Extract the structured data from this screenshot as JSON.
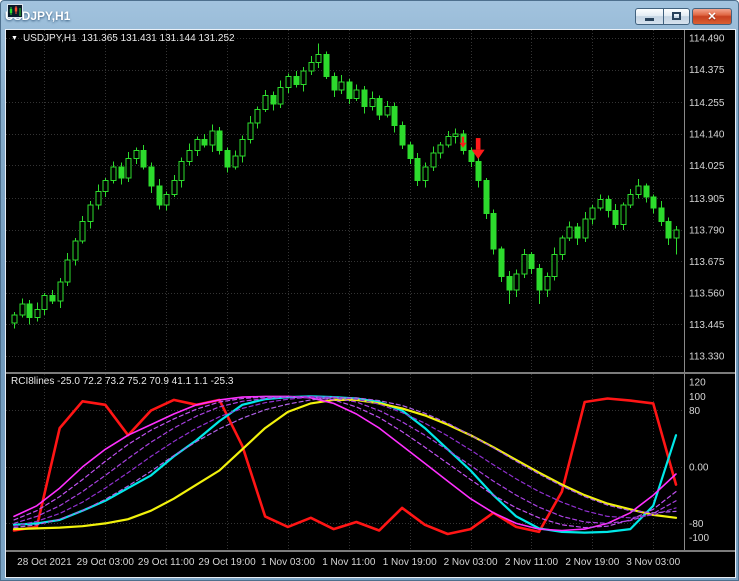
{
  "window": {
    "title": "USDJPY,H1",
    "close_glyph": "✕"
  },
  "main_chart": {
    "nav_arrow": "▼",
    "symbol": "USDJPY,H1",
    "ohlc": "131.365 131.431 131.144 131.252"
  },
  "indicator": {
    "info": "RCI8lines -25.0 72.2 73.2 75.2 70.9 41.1 1.1 -25.3"
  },
  "chart_data": [
    {
      "type": "candlestick",
      "title": "USDJPY H1",
      "grid_color": "#343434",
      "axis_text_color": "#d6d6d6",
      "candle_line_color": "#2ddb2d",
      "bull_fill": "#000000",
      "bear_fill": "#2ddb2d",
      "price_axis_labels": [
        "114.490",
        "114.375",
        "114.255",
        "114.140",
        "114.025",
        "113.905",
        "113.790",
        "113.675",
        "113.560",
        "113.445",
        "113.330"
      ],
      "time_axis_labels": [
        {
          "text": "28 Oct 2021",
          "bar": 4
        },
        {
          "text": "29 Oct 03:00",
          "bar": 12
        },
        {
          "text": "29 Oct 11:00",
          "bar": 20
        },
        {
          "text": "29 Oct 19:00",
          "bar": 28
        },
        {
          "text": "1 Nov 03:00",
          "bar": 36
        },
        {
          "text": "1 Nov 11:00",
          "bar": 44
        },
        {
          "text": "1 Nov 19:00",
          "bar": 52
        },
        {
          "text": "2 Nov 03:00",
          "bar": 60
        },
        {
          "text": "2 Nov 11:00",
          "bar": 68
        },
        {
          "text": "2 Nov 19:00",
          "bar": 76
        },
        {
          "text": "3 Nov 03:00",
          "bar": 84
        }
      ],
      "candles": [
        [
          113.45,
          113.49,
          113.43,
          113.48
        ],
        [
          113.48,
          113.54,
          113.47,
          113.52
        ],
        [
          113.52,
          113.535,
          113.445,
          113.47
        ],
        [
          113.47,
          113.525,
          113.455,
          113.5
        ],
        [
          113.5,
          113.56,
          113.48,
          113.55
        ],
        [
          113.55,
          113.57,
          113.52,
          113.53
        ],
        [
          113.53,
          113.615,
          113.505,
          113.6
        ],
        [
          113.6,
          113.705,
          113.585,
          113.68
        ],
        [
          113.68,
          113.76,
          113.66,
          113.75
        ],
        [
          113.75,
          113.84,
          113.74,
          113.82
        ],
        [
          113.82,
          113.895,
          113.795,
          113.88
        ],
        [
          113.88,
          113.955,
          113.865,
          113.93
        ],
        [
          113.93,
          113.98,
          113.91,
          113.97
        ],
        [
          113.97,
          114.04,
          113.96,
          114.02
        ],
        [
          114.02,
          114.035,
          113.955,
          113.98
        ],
        [
          113.98,
          114.075,
          113.965,
          114.05
        ],
        [
          114.05,
          114.09,
          114.03,
          114.08
        ],
        [
          114.08,
          114.1,
          114.01,
          114.02
        ],
        [
          114.02,
          114.035,
          113.925,
          113.95
        ],
        [
          113.95,
          113.975,
          113.865,
          113.88
        ],
        [
          113.88,
          113.93,
          113.86,
          113.92
        ],
        [
          113.92,
          113.99,
          113.91,
          113.97
        ],
        [
          113.97,
          114.055,
          113.945,
          114.04
        ],
        [
          114.04,
          114.105,
          114.025,
          114.08
        ],
        [
          114.08,
          114.13,
          114.06,
          114.12
        ],
        [
          114.12,
          114.14,
          114.09,
          114.1
        ],
        [
          114.1,
          114.175,
          114.075,
          114.15
        ],
        [
          114.15,
          114.165,
          114.065,
          114.08
        ],
        [
          114.08,
          114.09,
          114.0,
          114.02
        ],
        [
          114.02,
          114.08,
          114.01,
          114.06
        ],
        [
          114.06,
          114.135,
          114.035,
          114.12
        ],
        [
          114.12,
          114.205,
          114.105,
          114.18
        ],
        [
          114.18,
          114.24,
          114.16,
          114.23
        ],
        [
          114.23,
          114.3,
          114.22,
          114.28
        ],
        [
          114.28,
          114.295,
          114.225,
          114.25
        ],
        [
          114.25,
          114.335,
          114.235,
          114.31
        ],
        [
          114.31,
          114.36,
          114.29,
          114.35
        ],
        [
          114.35,
          114.37,
          114.31,
          114.32
        ],
        [
          114.32,
          114.385,
          114.295,
          114.37
        ],
        [
          114.37,
          114.425,
          114.355,
          114.4
        ],
        [
          114.4,
          114.47,
          114.38,
          114.43
        ],
        [
          114.43,
          114.44,
          114.34,
          114.35
        ],
        [
          114.35,
          114.365,
          114.275,
          114.3
        ],
        [
          114.3,
          114.355,
          114.285,
          114.33
        ],
        [
          114.33,
          114.34,
          114.25,
          114.27
        ],
        [
          114.27,
          114.32,
          114.26,
          114.3
        ],
        [
          114.3,
          114.315,
          114.215,
          114.24
        ],
        [
          114.24,
          114.295,
          114.225,
          114.27
        ],
        [
          114.27,
          114.28,
          114.19,
          114.21
        ],
        [
          114.21,
          114.26,
          114.2,
          114.24
        ],
        [
          114.24,
          114.255,
          114.145,
          114.17
        ],
        [
          114.17,
          114.185,
          114.085,
          114.1
        ],
        [
          114.1,
          114.11,
          114.03,
          114.05
        ],
        [
          114.05,
          114.07,
          113.95,
          113.97
        ],
        [
          113.97,
          114.035,
          113.945,
          114.02
        ],
        [
          114.02,
          114.095,
          114.005,
          114.07
        ],
        [
          114.07,
          114.11,
          114.05,
          114.1
        ],
        [
          114.1,
          114.15,
          114.09,
          114.13
        ],
        [
          114.13,
          114.16,
          114.105,
          114.14
        ],
        [
          114.14,
          114.155,
          114.065,
          114.08
        ],
        [
          114.08,
          114.09,
          114.02,
          114.04
        ],
        [
          114.04,
          114.055,
          113.945,
          113.97
        ],
        [
          113.97,
          113.98,
          113.83,
          113.85
        ],
        [
          113.85,
          113.865,
          113.7,
          113.72
        ],
        [
          113.72,
          113.73,
          113.6,
          113.62
        ],
        [
          113.62,
          113.64,
          113.52,
          113.57
        ],
        [
          113.57,
          113.645,
          113.545,
          113.63
        ],
        [
          113.63,
          113.72,
          113.615,
          113.7
        ],
        [
          113.7,
          113.71,
          113.63,
          113.65
        ],
        [
          113.65,
          113.665,
          113.52,
          113.57
        ],
        [
          113.57,
          113.635,
          113.545,
          113.62
        ],
        [
          113.62,
          113.725,
          113.605,
          113.7
        ],
        [
          113.7,
          113.77,
          113.68,
          113.76
        ],
        [
          113.76,
          113.82,
          113.75,
          113.8
        ],
        [
          113.8,
          113.815,
          113.735,
          113.76
        ],
        [
          113.76,
          113.855,
          113.745,
          113.83
        ],
        [
          113.83,
          113.88,
          113.81,
          113.87
        ],
        [
          113.87,
          113.92,
          113.86,
          113.9
        ],
        [
          113.9,
          113.915,
          113.835,
          113.86
        ],
        [
          113.86,
          113.885,
          113.795,
          113.81
        ],
        [
          113.81,
          113.89,
          113.79,
          113.88
        ],
        [
          113.88,
          113.94,
          113.87,
          113.92
        ],
        [
          113.92,
          113.975,
          113.905,
          113.95
        ],
        [
          113.95,
          113.96,
          113.89,
          113.91
        ],
        [
          113.91,
          113.92,
          113.85,
          113.87
        ],
        [
          113.87,
          113.895,
          113.805,
          113.82
        ],
        [
          113.82,
          113.835,
          113.735,
          113.76
        ],
        [
          113.76,
          113.805,
          113.7,
          113.79
        ]
      ],
      "annotations": [
        {
          "type": "arrow-down",
          "bar": 59,
          "price": 114.13,
          "size": 11,
          "color": "#ff1a1a"
        },
        {
          "type": "arrow-down",
          "bar": 61,
          "price": 114.125,
          "size": 21,
          "color": "#ff1a1a"
        }
      ]
    },
    {
      "type": "line",
      "name": "RCI8lines",
      "axis_labels": [
        "120",
        "100",
        "80",
        "0.00",
        "-80",
        "-100"
      ],
      "level_lines": [
        80,
        0,
        -80
      ],
      "y_range": [
        -112,
        126
      ],
      "x_bar_step": 3,
      "series": [
        {
          "name": "red",
          "color": "#ff1515",
          "width": 2.6,
          "dash": "",
          "values": [
            -90,
            -85,
            55,
            93,
            88,
            45,
            80,
            95,
            88,
            95,
            30,
            -70,
            -85,
            -72,
            -88,
            -78,
            -90,
            -58,
            -82,
            -95,
            -88,
            -65,
            -85,
            -92,
            -35,
            92,
            97,
            94,
            90,
            -25
          ]
        },
        {
          "name": "cyan",
          "color": "#00e8e8",
          "width": 2.2,
          "dash": "",
          "values": [
            -82,
            -80,
            -75,
            -62,
            -48,
            -30,
            -12,
            15,
            38,
            65,
            88,
            96,
            99,
            100,
            99,
            97,
            92,
            80,
            55,
            25,
            -5,
            -40,
            -70,
            -87,
            -92,
            -93,
            -92,
            -88,
            -55,
            45
          ]
        },
        {
          "name": "yellow",
          "color": "#f2f20c",
          "width": 2.2,
          "dash": "",
          "values": [
            -88,
            -87,
            -86,
            -84,
            -80,
            -74,
            -62,
            -45,
            -25,
            -5,
            25,
            55,
            78,
            90,
            95,
            95,
            90,
            83,
            73,
            60,
            45,
            28,
            10,
            -8,
            -25,
            -40,
            -52,
            -60,
            -68,
            -72
          ]
        },
        {
          "name": "magenta",
          "color": "#ff30ff",
          "width": 1.6,
          "dash": "",
          "values": [
            -70,
            -55,
            -30,
            0,
            25,
            45,
            60,
            75,
            88,
            95,
            99,
            100,
            100,
            98,
            90,
            75,
            55,
            30,
            5,
            -20,
            -45,
            -65,
            -80,
            -88,
            -90,
            -88,
            -80,
            -65,
            -40,
            -10
          ]
        },
        {
          "name": "violet-1",
          "color": "#c050f0",
          "width": 1.2,
          "dash": "4,3",
          "values": [
            -75,
            -62,
            -42,
            -18,
            8,
            32,
            52,
            68,
            82,
            92,
            97,
            99,
            100,
            99,
            95,
            85,
            70,
            50,
            28,
            5,
            -18,
            -40,
            -58,
            -72,
            -82,
            -86,
            -84,
            -75,
            -60,
            -35
          ]
        },
        {
          "name": "violet-2",
          "color": "#a840e0",
          "width": 1.2,
          "dash": "4,3",
          "values": [
            -80,
            -70,
            -55,
            -35,
            -12,
            12,
            35,
            55,
            72,
            85,
            93,
            97,
            99,
            100,
            98,
            92,
            80,
            64,
            45,
            24,
            2,
            -20,
            -40,
            -57,
            -70,
            -78,
            -80,
            -76,
            -66,
            -48
          ]
        },
        {
          "name": "violet-3",
          "color": "#9030d0",
          "width": 1.2,
          "dash": "4,3",
          "values": [
            -84,
            -77,
            -66,
            -50,
            -30,
            -8,
            15,
            36,
            55,
            71,
            83,
            91,
            96,
            99,
            99,
            96,
            89,
            77,
            62,
            44,
            24,
            3,
            -17,
            -35,
            -50,
            -62,
            -70,
            -72,
            -68,
            -58
          ]
        },
        {
          "name": "violet-4",
          "color": "#b060e8",
          "width": 1.2,
          "dash": "4,3",
          "values": [
            -86,
            -82,
            -74,
            -62,
            -46,
            -27,
            -6,
            16,
            36,
            54,
            69,
            81,
            89,
            95,
            98,
            98,
            94,
            87,
            76,
            62,
            45,
            27,
            8,
            -10,
            -27,
            -42,
            -54,
            -62,
            -65,
            -63
          ]
        }
      ]
    }
  ]
}
